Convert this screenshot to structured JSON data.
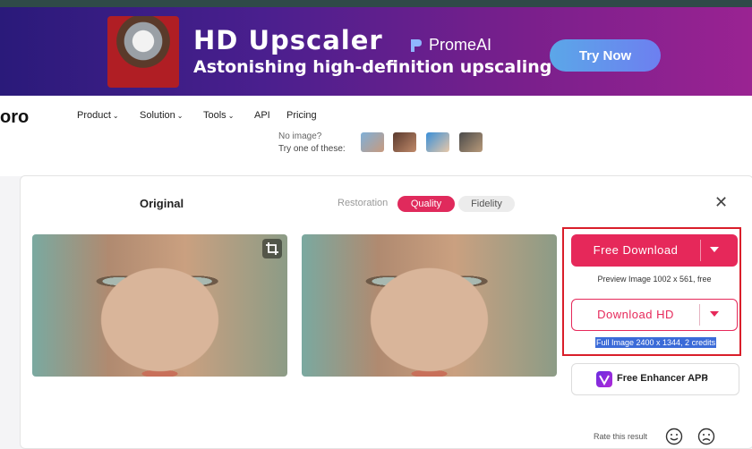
{
  "banner": {
    "title": "HD Upscaler",
    "subtitle": "Astonishing high-definition upscaling",
    "brand": "PromeAI",
    "cta": "Try Now",
    "brand_color": "#7a1f8c",
    "cta_color": "#5ba7e8"
  },
  "nav": {
    "logo_fragment": "oro",
    "items": [
      {
        "label": "Product",
        "dropdown": true
      },
      {
        "label": "Solution",
        "dropdown": true
      },
      {
        "label": "Tools",
        "dropdown": true
      },
      {
        "label": "API",
        "dropdown": false
      },
      {
        "label": "Pricing",
        "dropdown": false
      }
    ]
  },
  "samples": {
    "no_image": "No image?",
    "try_one": "Try one of these:"
  },
  "panel": {
    "original_label": "Original",
    "mode_label": "Restoration",
    "tabs": [
      {
        "label": "Quality",
        "active": true
      },
      {
        "label": "Fidelity",
        "active": false
      }
    ],
    "close_icon": "close-icon",
    "crop_icon": "crop-icon"
  },
  "download": {
    "free_label": "Free Download",
    "preview_info": "Preview Image 1002 x 561, free",
    "hd_label": "Download HD",
    "full_info": "Full Image 2400 x 1344, 2 credits",
    "accent_color": "#e6285a"
  },
  "enhancer": {
    "label": "Free Enhancer APP",
    "chevron": "›"
  },
  "rating": {
    "label": "Rate this result",
    "icons": [
      "smile-icon",
      "frown-icon"
    ]
  }
}
